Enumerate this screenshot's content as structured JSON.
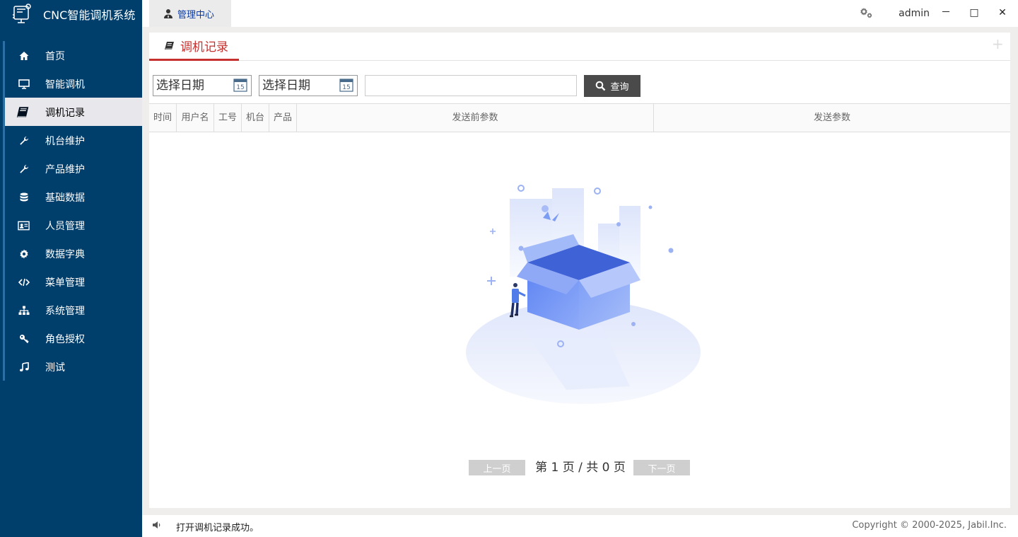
{
  "app": {
    "title": "CNC智能调机系统"
  },
  "topbar": {
    "tab_label": "管理中心",
    "user": "admin",
    "min": "－",
    "max": "□",
    "close": "✕"
  },
  "sidebar": {
    "items": [
      {
        "label": "首页",
        "icon": "home-icon"
      },
      {
        "label": "智能调机",
        "icon": "monitor-icon"
      },
      {
        "label": "调机记录",
        "icon": "book-icon",
        "active": true
      },
      {
        "label": "机台维护",
        "icon": "wrench-icon"
      },
      {
        "label": "产品维护",
        "icon": "wrench-icon"
      },
      {
        "label": "基础数据",
        "icon": "database-icon"
      },
      {
        "label": "人员管理",
        "icon": "id-card-icon"
      },
      {
        "label": "数据字典",
        "icon": "gear-icon"
      },
      {
        "label": "菜单管理",
        "icon": "code-icon"
      },
      {
        "label": "系统管理",
        "icon": "sitemap-icon"
      },
      {
        "label": "角色授权",
        "icon": "key-icon"
      },
      {
        "label": "测试",
        "icon": "music-icon"
      }
    ]
  },
  "panel": {
    "tab_label": "调机记录"
  },
  "filters": {
    "start_placeholder": "选择日期",
    "end_placeholder": "选择日期",
    "calendar_day": "15",
    "keyword_value": "",
    "search_label": "查询"
  },
  "table": {
    "columns": [
      "时间",
      "用户名",
      "工号",
      "机台",
      "产品",
      "发送前参数",
      "发送参数"
    ]
  },
  "pager": {
    "prev": "上一页",
    "info": "第 1 页 / 共 0 页",
    "next": "下一页"
  },
  "status": {
    "message": "打开调机记录成功。",
    "copyright": "Copyright © 2000-2025, Jabil.Inc."
  },
  "colors": {
    "sidebar": "#003e6b",
    "accent": "#c6302e",
    "search_btn": "#4a4a4a"
  }
}
